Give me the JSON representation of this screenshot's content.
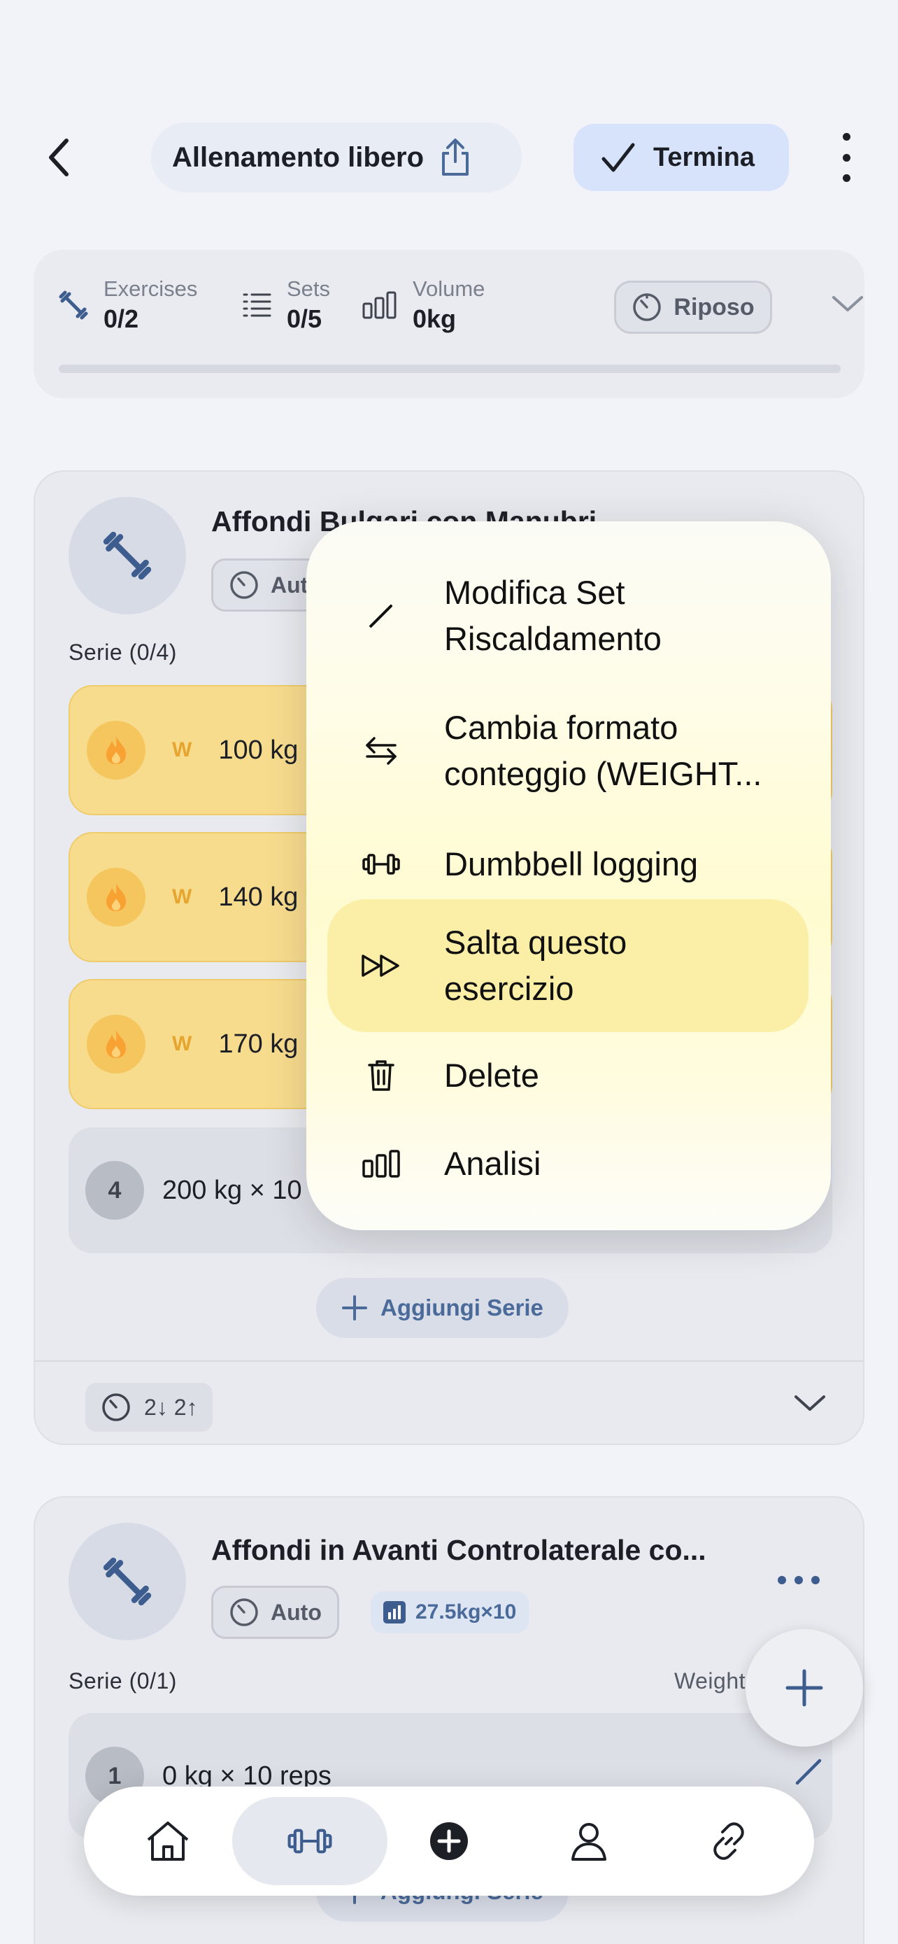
{
  "header": {
    "title": "Allenamento libero",
    "finish_label": "Termina",
    "icons": [
      "back-icon",
      "share-icon",
      "check-icon",
      "more-vertical-icon"
    ]
  },
  "stats": {
    "exercises_label": "Exercises",
    "exercises_value": "0/2",
    "sets_label": "Sets",
    "sets_value": "0/5",
    "volume_label": "Volume",
    "volume_value": "0kg",
    "rest_label": "Riposo",
    "progress_fraction": 0
  },
  "exercise1": {
    "title": "Affondi Bulgari con Manubri",
    "auto_label": "Auto",
    "series_label": "Serie (0/4)",
    "sets": [
      {
        "type": "W",
        "text": "100 kg"
      },
      {
        "type": "W",
        "text": "140 kg"
      },
      {
        "type": "W",
        "text": "170 kg"
      },
      {
        "type": "4",
        "text": "200 kg × 10"
      }
    ],
    "add_series_label": "Aggiungi Serie",
    "timer_label": "2↓ 2↑"
  },
  "exercise2": {
    "title": "Affondi in Avanti Controlaterale co...",
    "auto_label": "Auto",
    "stat_label": "27.5kg×10",
    "series_label": "Serie (0/1)",
    "weight_label": "Weight",
    "set": {
      "num": "1",
      "text": "0 kg × 10 reps"
    },
    "add_series_label": "Aggiungi Serie"
  },
  "context_menu": {
    "items": [
      {
        "label1": "Modifica Set",
        "label2": "Riscaldamento",
        "icon": "pencil-icon"
      },
      {
        "label1": "Cambia formato",
        "label2": "conteggio (WEIGHT...",
        "icon": "swap-arrows-icon"
      },
      {
        "label1": "Dumbbell logging",
        "label2": "",
        "icon": "dumbbell-icon"
      },
      {
        "label1": "Salta questo",
        "label2": "esercizio",
        "icon": "skip-forward-icon"
      },
      {
        "label1": "Delete",
        "label2": "",
        "icon": "trash-icon"
      },
      {
        "label1": "Analisi",
        "label2": "",
        "icon": "bar-chart-icon"
      }
    ]
  },
  "bottom_nav": [
    "home-icon",
    "dumbbell-icon",
    "plus-circle-icon",
    "profile-icon",
    "link-icon"
  ],
  "colors": {
    "background": "#f1f3f8",
    "accent_blue": "#4a6a9a",
    "warmup_yellow": "#f8dc8e",
    "finish_pill": "#d7e3fa"
  }
}
